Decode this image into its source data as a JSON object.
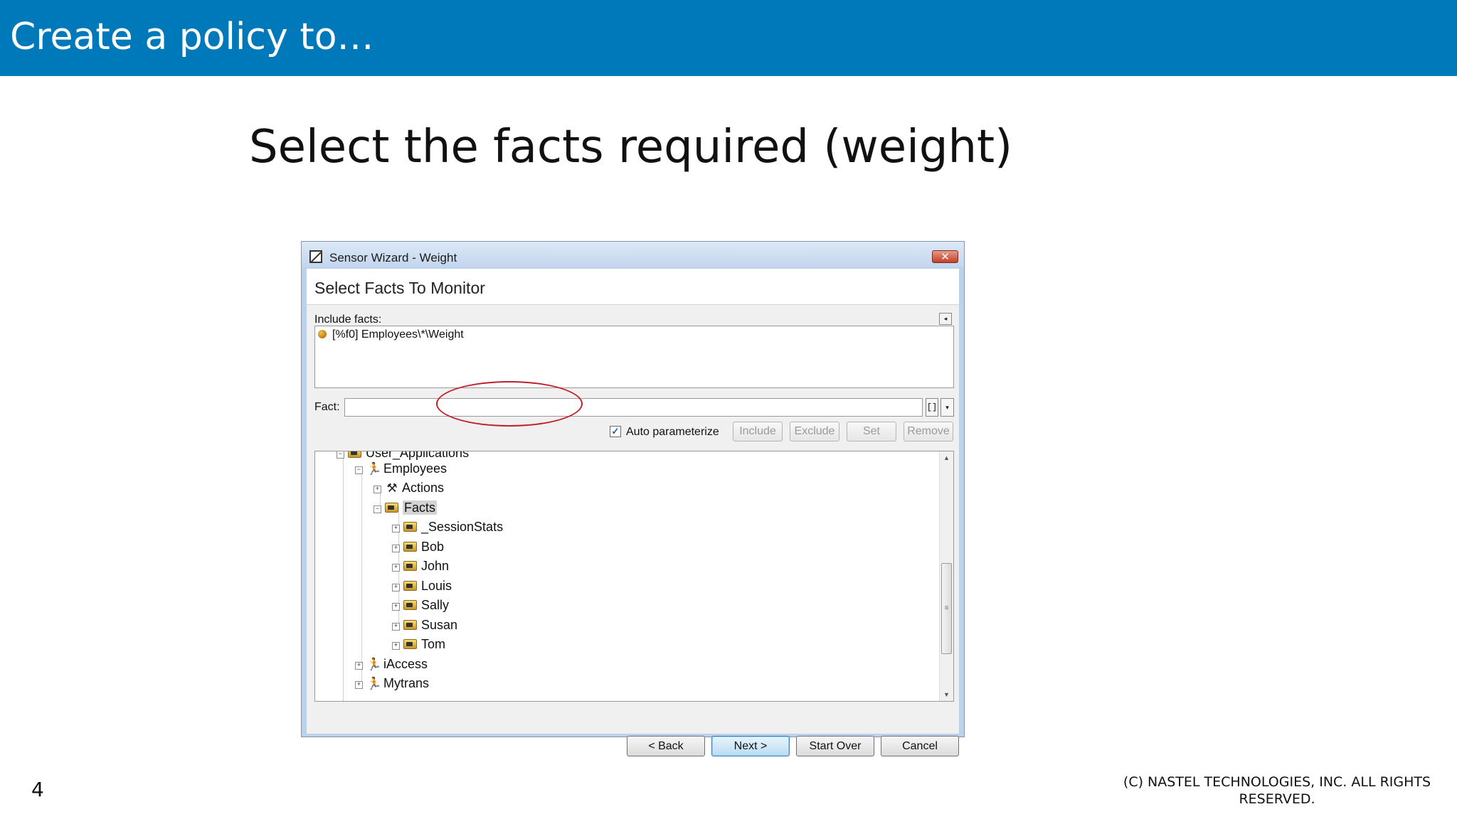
{
  "slide": {
    "title": "Create a policy to…",
    "subtitle": "Select the facts required (weight)",
    "page_number": "4",
    "copyright": "(C) NASTEL TECHNOLOGIES, INC. ALL RIGHTS RESERVED."
  },
  "dialog": {
    "title": "Sensor Wizard - Weight",
    "close_symbol": "✕",
    "header": "Select Facts To Monitor",
    "include_label": "Include facts:",
    "collapse_symbol": "◂",
    "included_facts": [
      "[%f0] Employees\\*\\Weight"
    ],
    "fact_label": "Fact:",
    "fact_value": "",
    "param_symbol": "[]",
    "dropdown_symbol": "▾",
    "auto_parameterize_checked": true,
    "auto_parameterize_label": "Auto parameterize",
    "buttons": {
      "include": "Include",
      "exclude": "Exclude",
      "set": "Set",
      "remove": "Remove"
    },
    "tree": {
      "partial_top": "User_Applications",
      "app": "Employees",
      "actions": "Actions",
      "facts": "Facts",
      "fact_children": [
        "_SessionStats",
        "Bob",
        "John",
        "Louis",
        "Sally",
        "Susan",
        "Tom"
      ],
      "other_apps": [
        "iAccess",
        "Mytrans"
      ],
      "expand_plus": "+",
      "expand_minus": "−"
    },
    "nav": {
      "back": "< Back",
      "next": "Next >",
      "start_over": "Start Over",
      "cancel": "Cancel"
    }
  },
  "annotation_color": "#c0202a",
  "icons": {
    "title": "window-icon",
    "app": "application-runner-icon",
    "actions": "tools-icon",
    "folder": "folder-icon",
    "fact": "fact-bullet-icon"
  }
}
